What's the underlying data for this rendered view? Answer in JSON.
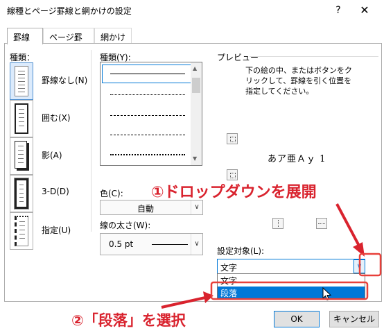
{
  "window": {
    "title": "線種とページ罫線と網かけの設定",
    "help_glyph": "?",
    "close_glyph": "✕"
  },
  "tabs": [
    {
      "label": "罫線",
      "active": true
    },
    {
      "label": "ページ罫線",
      "active": false
    },
    {
      "label": "網かけ",
      "active": false
    }
  ],
  "settings": {
    "header": "種類：",
    "items": [
      {
        "label": "罫線なし(N)",
        "selected": true,
        "icon": "no-border-icon"
      },
      {
        "label": "囲む(X)",
        "selected": false,
        "icon": "box-border-icon"
      },
      {
        "label": "影(A)",
        "selected": false,
        "icon": "shadow-border-icon"
      },
      {
        "label": "3-D(D)",
        "selected": false,
        "icon": "3d-border-icon"
      },
      {
        "label": "指定(U)",
        "selected": false,
        "icon": "custom-border-icon"
      }
    ]
  },
  "style": {
    "header": "種類(Y):",
    "line_samples": [
      "solid",
      "dotted",
      "dashed-small",
      "dashed",
      "dash-dot"
    ]
  },
  "color": {
    "label": "色(C):",
    "value": "自動"
  },
  "width": {
    "label": "線の太さ(W):",
    "value": "0.5 pt"
  },
  "preview": {
    "header": "プレビュー",
    "instructions": "下の絵の中、またはボタンをクリックして、罫線を引く位置を指定してください。",
    "sample_text": "あア亜Ａｙ 1"
  },
  "apply_to": {
    "label": "設定対象(L):",
    "value": "文字",
    "options": [
      "文字",
      "段落"
    ],
    "highlighted_option": "段落"
  },
  "buttons": {
    "ok": "OK",
    "cancel": "キャンセル"
  },
  "annotations": {
    "step1": "①ドロップダウンを展開",
    "step2": "②「段落」を選択",
    "color": "#d9232e"
  }
}
